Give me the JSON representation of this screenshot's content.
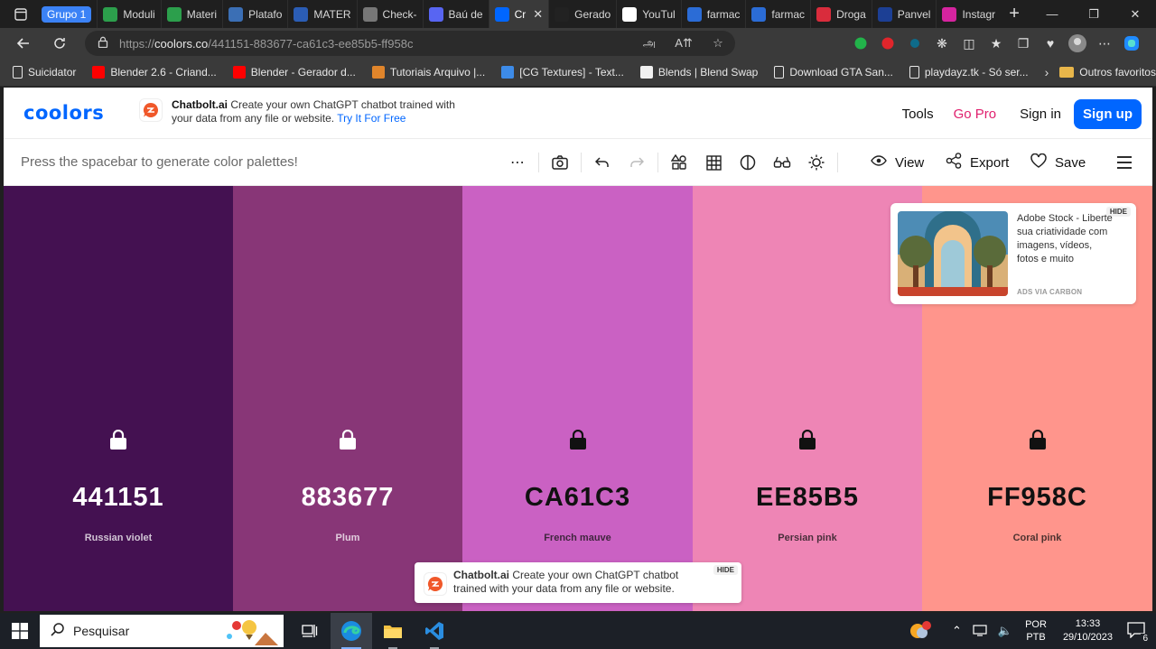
{
  "browser": {
    "tab_group_label": "Grupo 1",
    "tabs": [
      {
        "label": "Moduli",
        "icon": "drive-icon",
        "color": "#2c9f4c"
      },
      {
        "label": "Materi",
        "icon": "drive-icon",
        "color": "#2c9f4c"
      },
      {
        "label": "Platafo",
        "icon": "globe-icon",
        "color": "#3b6fb5"
      },
      {
        "label": "MATER",
        "icon": "classroom-icon",
        "color": "#2b5db5"
      },
      {
        "label": "Check-",
        "icon": "page-icon",
        "color": "#777777"
      },
      {
        "label": "Baú de",
        "icon": "discord-icon",
        "color": "#5865f2"
      },
      {
        "label": "Cr",
        "icon": "coolors-icon",
        "color": "#0066ff",
        "active": true
      },
      {
        "label": "Gerado",
        "icon": "p-icon",
        "color": "#222222"
      },
      {
        "label": "YouTul",
        "icon": "google-icon",
        "color": "#ffffff"
      },
      {
        "label": "farmac",
        "icon": "search-icon",
        "color": "#2b6cd6"
      },
      {
        "label": "farmac",
        "icon": "search-icon",
        "color": "#2b6cd6"
      },
      {
        "label": "Droga",
        "icon": "drogasil-icon",
        "color": "#d92c3c"
      },
      {
        "label": "Panvel",
        "icon": "panvel-icon",
        "color": "#1c3f94"
      },
      {
        "label": "Instagr",
        "icon": "instagram-icon",
        "color": "#d6249f"
      }
    ],
    "url_prefix": "https://",
    "url_host": "coolors.co",
    "url_path": "/441151-883677-ca61c3-ee85b5-ff958c",
    "bookmarks": [
      {
        "label": "Suicidator",
        "icon": "page-icon"
      },
      {
        "label": "Blender 2.6 - Criand...",
        "icon": "youtube-icon"
      },
      {
        "label": "Blender - Gerador d...",
        "icon": "youtube-icon"
      },
      {
        "label": "Tutoriais Arquivo |...",
        "icon": "site-icon"
      },
      {
        "label": "[CG Textures] - Text...",
        "icon": "cube-icon"
      },
      {
        "label": "Blends | Blend Swap",
        "icon": "blend-icon"
      },
      {
        "label": "Download GTA San...",
        "icon": "page-icon"
      },
      {
        "label": "playdayz.tk - Só ser...",
        "icon": "page-icon"
      }
    ],
    "other_favorites": "Outros favoritos"
  },
  "site": {
    "logo": "coolors",
    "top_ad": {
      "brand": "Chatbolt.ai",
      "text": " Create your own ChatGPT chatbot trained with your data from any file or website.",
      "cta": "Try It For Free"
    },
    "nav": {
      "tools": "Tools",
      "gopro": "Go Pro",
      "signin": "Sign in",
      "signup": "Sign up"
    },
    "toolbar": {
      "hint": "Press the spacebar to generate color palettes!",
      "view": "View",
      "export": "Export",
      "save": "Save"
    },
    "palette": [
      {
        "hex": "441151",
        "name": "Russian violet",
        "color": "#441151",
        "text": "#ffffff",
        "locked": false
      },
      {
        "hex": "883677",
        "name": "Plum",
        "color": "#883677",
        "text": "#ffffff",
        "locked": false
      },
      {
        "hex": "CA61C3",
        "name": "French mauve",
        "color": "#CA61C3",
        "text": "#111111",
        "locked": false
      },
      {
        "hex": "EE85B5",
        "name": "Persian pink",
        "color": "#EE85B5",
        "text": "#111111",
        "locked": false
      },
      {
        "hex": "FF958C",
        "name": "Coral pink",
        "color": "#FF958C",
        "text": "#111111",
        "locked": false
      }
    ],
    "carbon_ad": {
      "hide": "HIDE",
      "text": "Adobe Stock - Liberte sua criatividade com imagens, vídeos, fotos e muito",
      "via": "ADS VIA CARBON"
    },
    "bottom_ad": {
      "brand": "Chatbolt.ai",
      "text": " Create your own ChatGPT chatbot trained with your data from any file or website.",
      "hide": "HIDE"
    }
  },
  "taskbar": {
    "search_placeholder": "Pesquisar",
    "lang_1": "POR",
    "lang_2": "PTB",
    "time": "13:33",
    "date": "29/10/2023",
    "notifications": "6"
  }
}
